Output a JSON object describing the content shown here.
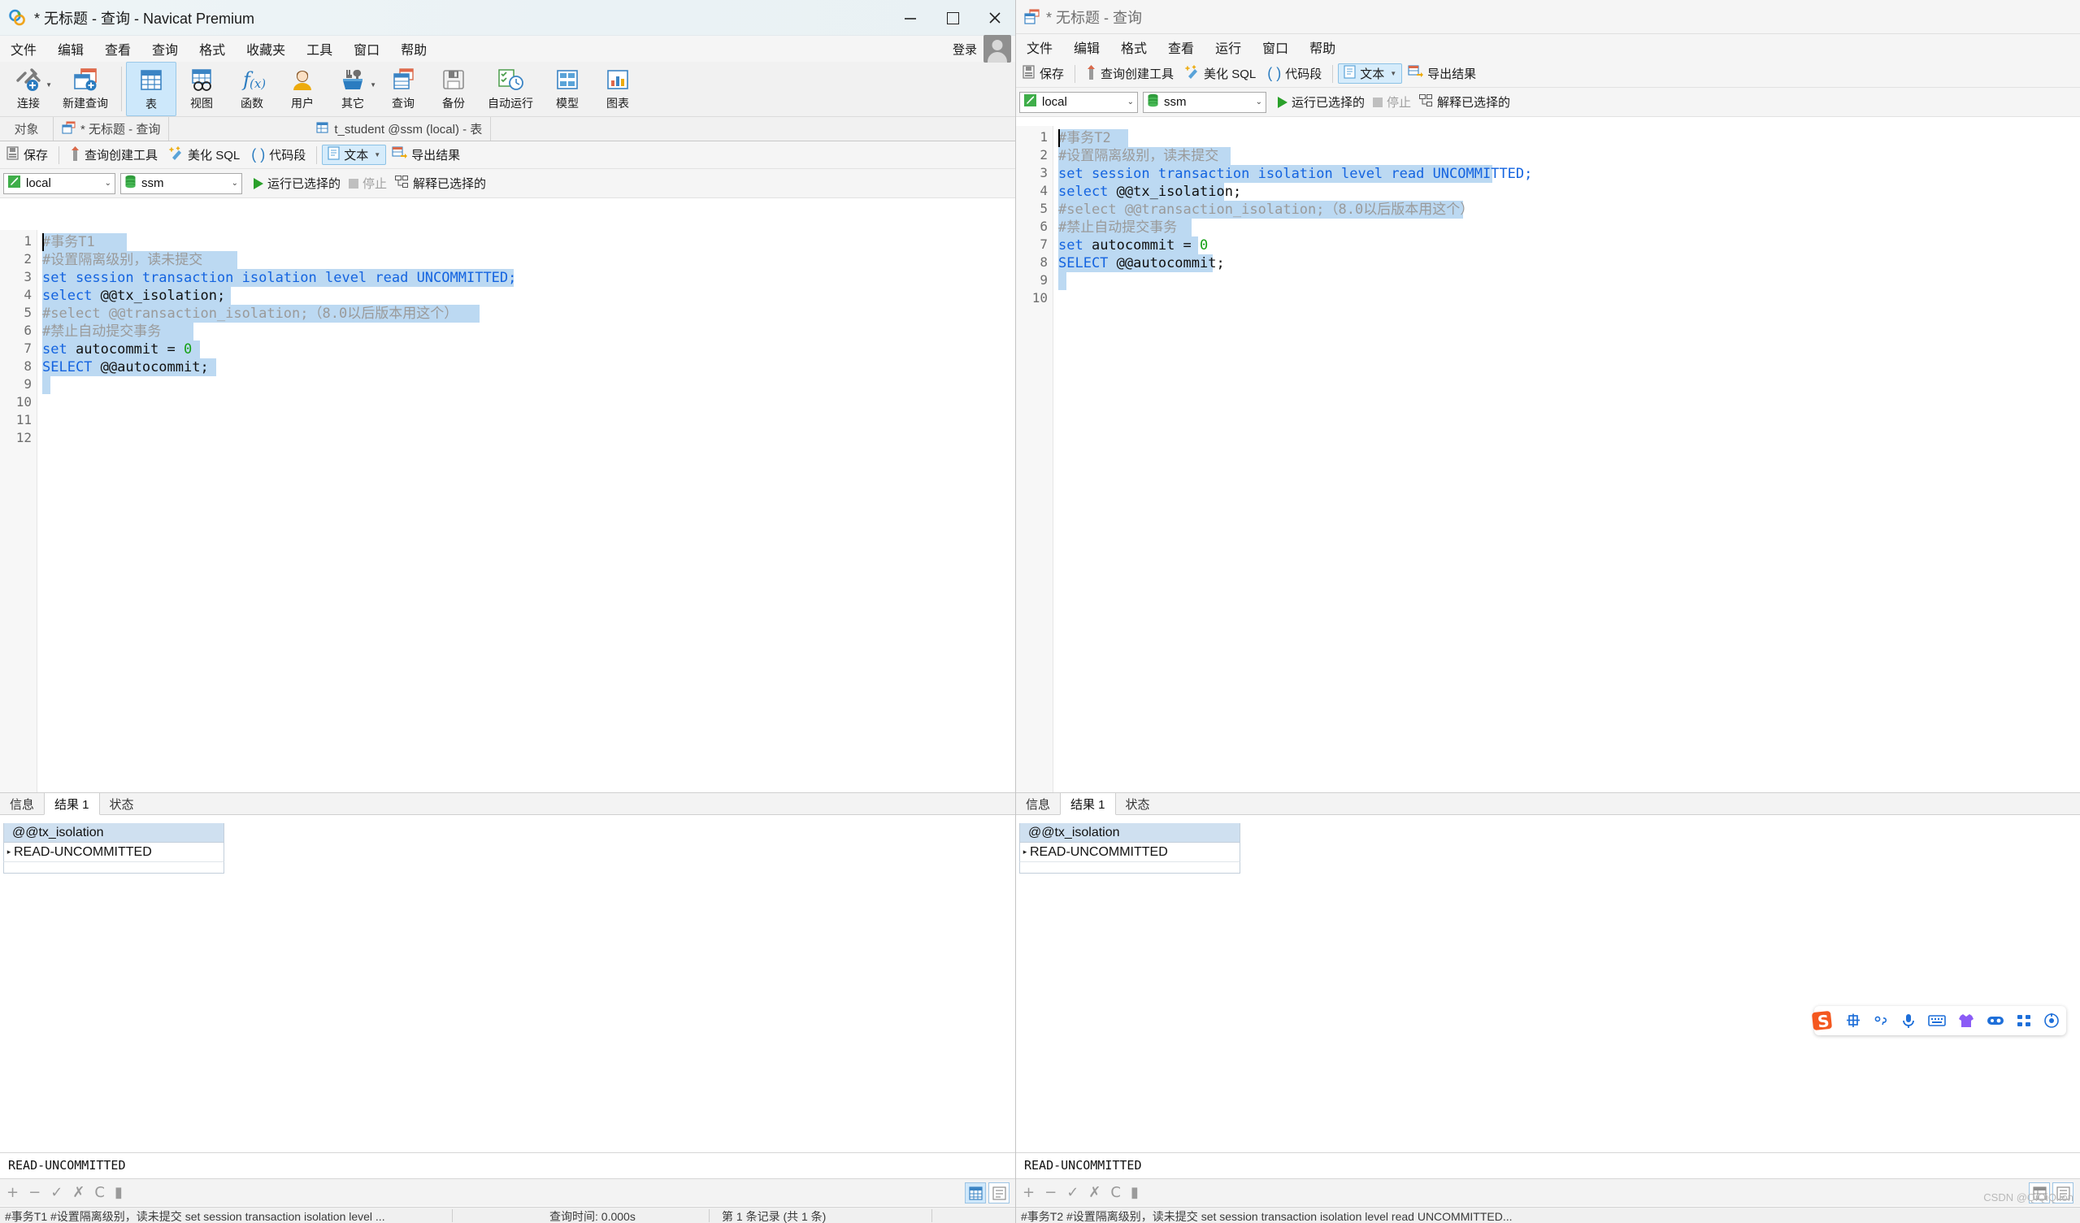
{
  "left_window": {
    "title": "* 无标题 - 查询 - Navicat Premium",
    "window_controls": {
      "minimize": "minimize-icon",
      "maximize": "maximize-icon",
      "close": "close-icon"
    },
    "menu": [
      "文件",
      "编辑",
      "查看",
      "查询",
      "格式",
      "收藏夹",
      "工具",
      "窗口",
      "帮助"
    ],
    "login_label": "登录",
    "ribbon": [
      {
        "label": "连接",
        "icon": "connection-icon",
        "caret": true
      },
      {
        "label": "新建查询",
        "icon": "new-query-icon",
        "caret": false
      },
      {
        "label": "表",
        "icon": "table-icon",
        "selected": true
      },
      {
        "label": "视图",
        "icon": "view-icon"
      },
      {
        "label": "函数",
        "icon": "function-icon"
      },
      {
        "label": "用户",
        "icon": "user-icon"
      },
      {
        "label": "其它",
        "icon": "other-icon",
        "caret": true
      },
      {
        "label": "查询",
        "icon": "query-icon"
      },
      {
        "label": "备份",
        "icon": "backup-icon"
      },
      {
        "label": "自动运行",
        "icon": "automation-icon"
      },
      {
        "label": "模型",
        "icon": "model-icon"
      },
      {
        "label": "图表",
        "icon": "chart-icon"
      }
    ],
    "tabstrip": {
      "objects_label": "对象",
      "tabs": [
        {
          "label": "* 无标题 - 查询",
          "icon": "query-tab-icon",
          "active": false
        },
        {
          "label": "t_student @ssm (local) - 表",
          "icon": "table-tab-icon",
          "active": false
        }
      ]
    },
    "query_toolbar": {
      "save": "保存",
      "query_builder": "查询创建工具",
      "beautify_sql": "美化 SQL",
      "code_snippet": "代码段",
      "text": "文本",
      "export_result": "导出结果"
    },
    "connection_bar": {
      "connection": "local",
      "database": "ssm",
      "run_selected": "运行已选择的",
      "stop": "停止",
      "explain_selected": "解释已选择的"
    },
    "editor": {
      "line_numbers": [
        "1",
        "2",
        "3",
        "4",
        "5",
        "6",
        "7",
        "8",
        "9",
        "10",
        "11",
        "12"
      ],
      "lines": [
        {
          "n": 1,
          "sel_w": 104,
          "tokens": [
            {
              "t": "#事务T1",
              "c": "cmt"
            }
          ]
        },
        {
          "n": 2,
          "sel_w": 240,
          "tokens": [
            {
              "t": "#设置隔离级别，读未提交",
              "c": "cmt"
            }
          ]
        },
        {
          "n": 3,
          "sel_w": 580,
          "tokens": [
            {
              "t": "set session transaction isolation level read UNCOMMITTED;",
              "c": "kw"
            }
          ]
        },
        {
          "n": 4,
          "sel_w": 232,
          "tokens": [
            {
              "t": "select ",
              "c": "kw"
            },
            {
              "t": "@@tx_isolation;",
              "c": "var"
            }
          ]
        },
        {
          "n": 5,
          "sel_w": 538,
          "tokens": [
            {
              "t": "#select @@transaction_isolation;（8.0以后版本用这个）",
              "c": "cmt"
            }
          ]
        },
        {
          "n": 6,
          "sel_w": 186,
          "tokens": [
            {
              "t": "#禁止自动提交事务",
              "c": "cmt"
            }
          ]
        },
        {
          "n": 7,
          "sel_w": 194,
          "tokens": [
            {
              "t": "set ",
              "c": "kw"
            },
            {
              "t": "autocommit = ",
              "c": "plain"
            },
            {
              "t": "0",
              "c": "num"
            }
          ]
        },
        {
          "n": 8,
          "sel_w": 214,
          "tokens": [
            {
              "t": "SELECT ",
              "c": "kw"
            },
            {
              "t": "@@autocommit;",
              "c": "var"
            }
          ]
        },
        {
          "n": 9,
          "sel_w": 10,
          "tokens": []
        },
        {
          "n": 10,
          "sel_w": 0,
          "tokens": []
        },
        {
          "n": 11,
          "sel_w": 0,
          "tokens": []
        },
        {
          "n": 12,
          "sel_w": 0,
          "tokens": []
        }
      ]
    },
    "results": {
      "tabs": [
        {
          "label": "信息",
          "active": false
        },
        {
          "label": "结果 1",
          "active": true
        },
        {
          "label": "状态",
          "active": false
        }
      ],
      "column_header": "@@tx_isolation",
      "rows": [
        {
          "marker": "▸",
          "value": "READ-UNCOMMITTED"
        }
      ]
    },
    "value_editor": "READ-UNCOMMITTED",
    "nav_buttons": [
      "+",
      "−",
      "✓",
      "✗",
      "C",
      "▮"
    ],
    "statusbar": {
      "sql": "#事务T1 #设置隔离级别，读未提交 set session transaction isolation level ...",
      "segment2": "查询时间: 0.000s",
      "segment3": "第 1 条记录 (共 1 条)"
    }
  },
  "right_window": {
    "title": "* 无标题 - 查询",
    "menu": [
      "文件",
      "编辑",
      "格式",
      "查看",
      "运行",
      "窗口",
      "帮助"
    ],
    "query_toolbar": {
      "save": "保存",
      "query_builder": "查询创建工具",
      "beautify_sql": "美化 SQL",
      "code_snippet": "代码段",
      "text": "文本",
      "export_result": "导出结果"
    },
    "connection_bar": {
      "connection": "local",
      "database": "ssm",
      "run_selected": "运行已选择的",
      "stop": "停止",
      "explain_selected": "解释已选择的"
    },
    "editor": {
      "line_numbers": [
        "1",
        "2",
        "3",
        "4",
        "5",
        "6",
        "7",
        "8",
        "9",
        "10"
      ],
      "lines": [
        {
          "n": 1,
          "sel_w": 86,
          "tokens": [
            {
              "t": "#事务T2",
              "c": "cmt"
            }
          ]
        },
        {
          "n": 2,
          "sel_w": 212,
          "tokens": [
            {
              "t": "#设置隔离级别，读未提交",
              "c": "cmt"
            }
          ]
        },
        {
          "n": 3,
          "sel_w": 534,
          "tokens": [
            {
              "t": "set session transaction isolation level read UNCOMMITTED;",
              "c": "kw"
            }
          ]
        },
        {
          "n": 4,
          "sel_w": 204,
          "tokens": [
            {
              "t": "select ",
              "c": "kw"
            },
            {
              "t": "@@tx_isolation;",
              "c": "var"
            }
          ]
        },
        {
          "n": 5,
          "sel_w": 498,
          "tokens": [
            {
              "t": "#select @@transaction_isolation;（8.0以后版本用这个）",
              "c": "cmt"
            }
          ]
        },
        {
          "n": 6,
          "sel_w": 164,
          "tokens": [
            {
              "t": "#禁止自动提交事务",
              "c": "cmt"
            }
          ]
        },
        {
          "n": 7,
          "sel_w": 172,
          "tokens": [
            {
              "t": "set ",
              "c": "kw"
            },
            {
              "t": "autocommit = ",
              "c": "plain"
            },
            {
              "t": "0",
              "c": "num"
            }
          ]
        },
        {
          "n": 8,
          "sel_w": 190,
          "tokens": [
            {
              "t": "SELECT ",
              "c": "kw"
            },
            {
              "t": "@@autocommit;",
              "c": "var"
            }
          ]
        },
        {
          "n": 9,
          "sel_w": 10,
          "tokens": []
        },
        {
          "n": 10,
          "sel_w": 0,
          "tokens": []
        }
      ]
    },
    "results": {
      "tabs": [
        {
          "label": "信息",
          "active": false
        },
        {
          "label": "结果 1",
          "active": true
        },
        {
          "label": "状态",
          "active": false
        }
      ],
      "column_header": "@@tx_isolation",
      "rows": [
        {
          "marker": "▸",
          "value": "READ-UNCOMMITTED"
        }
      ]
    },
    "value_editor": "READ-UNCOMMITTED",
    "nav_buttons": [
      "+",
      "−",
      "✓",
      "✗",
      "C",
      "▮"
    ],
    "statusbar": {
      "sql": "#事务T2 #设置隔离级别，读未提交 set session transaction isolation level read UNCOMMITTED..."
    }
  },
  "ime_toolbar": {
    "icons": [
      "sogou-logo-icon",
      "chinese-mode-icon",
      "punctuation-icon",
      "microphone-icon",
      "keyboard-icon",
      "skin-icon",
      "toolbox-icon",
      "apps-icon",
      "settings-icon"
    ]
  },
  "watermark": "CSDN @QiQiQiIon",
  "colors": {
    "accent": "#1464e0",
    "selection": "#bcd9f2",
    "comment": "#9a9a9a",
    "number": "#15a015",
    "header": "#cfe0f0",
    "run_green": "#2aa02a"
  }
}
